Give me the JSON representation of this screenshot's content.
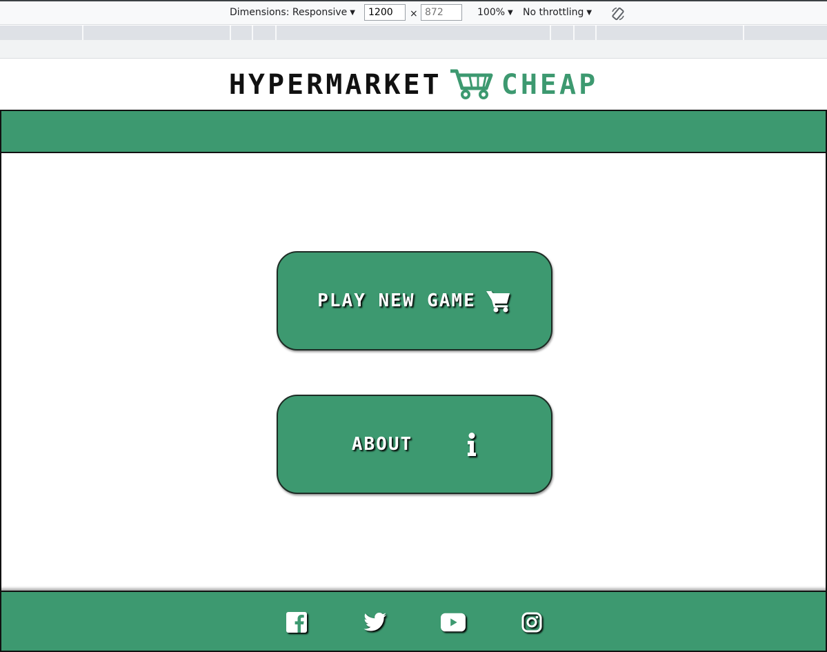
{
  "devtools": {
    "dimensions_label": "Dimensions: Responsive",
    "width_value": "1200",
    "times_symbol": "×",
    "height_placeholder": "872",
    "zoom_label": "100%",
    "throttling_label": "No throttling"
  },
  "site": {
    "logo_text_dark": "HYPERMARKET",
    "logo_text_green": "CHEAP",
    "buttons": {
      "play_label": "PLAY NEW GAME",
      "about_label": "ABOUT"
    }
  },
  "colors": {
    "accent_green": "#3d9970",
    "border_dark": "#111111"
  },
  "icons": [
    "cart-icon",
    "info-icon",
    "facebook-icon",
    "twitter-icon",
    "youtube-icon",
    "instagram-icon",
    "rotate-icon"
  ]
}
